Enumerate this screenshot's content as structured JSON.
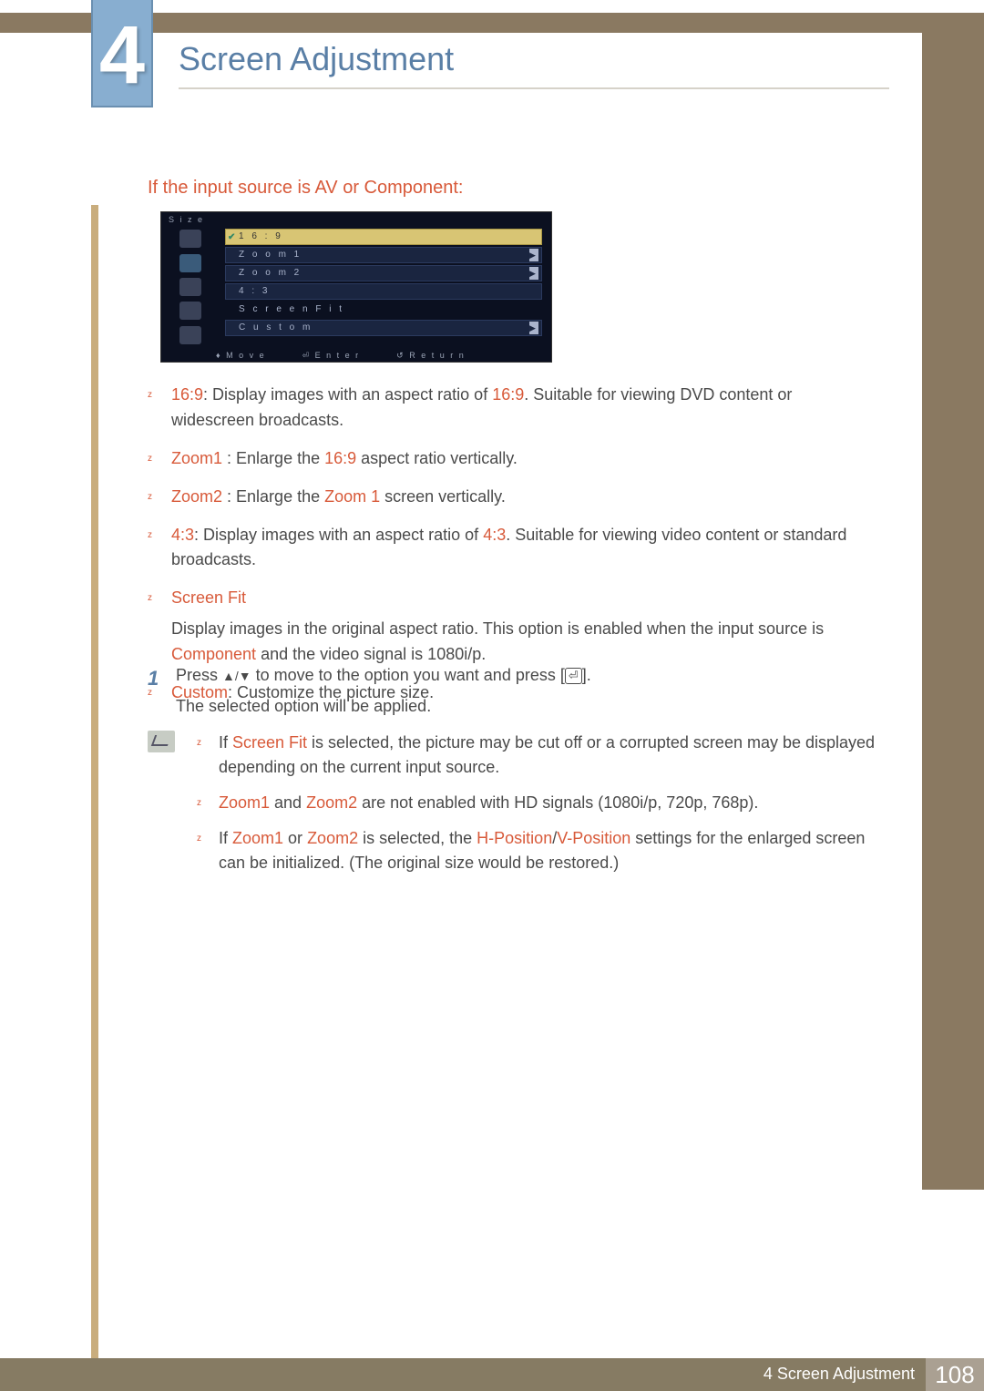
{
  "chapter": {
    "number": "4",
    "title": "Screen Adjustment"
  },
  "section_heading": "If the input source is AV or Component:",
  "osd": {
    "title": "S i z e",
    "rows": {
      "r0": "1 6 : 9",
      "r1": "Z o o m 1",
      "r2": "Z o o m 2",
      "r3": "4 : 3",
      "r4": "S c r e e n  F i t",
      "r5": "C u s t o m"
    },
    "footer": {
      "move": "M o v e",
      "enter": "E n t e r",
      "return": "R e t u r n"
    }
  },
  "items": {
    "i0": {
      "term": "16:9",
      "rest": ": Display images with an aspect ratio of ",
      "term2": "16:9",
      "rest2": ". Suitable for viewing DVD content or widescreen broadcasts."
    },
    "i1": {
      "term": "Zoom1",
      "rest": " : Enlarge the ",
      "term2": "16:9",
      "rest2": " aspect ratio vertically."
    },
    "i2": {
      "term": "Zoom2",
      "rest": " : Enlarge the ",
      "term2": "Zoom 1",
      "rest2": " screen vertically."
    },
    "i3": {
      "term": "4:3",
      "rest": ": Display images with an aspect ratio of ",
      "term2": "4:3",
      "rest2": ". Suitable for viewing video content or standard broadcasts."
    },
    "i4": {
      "term": "Screen Fit",
      "sub1a": "Display images in the original aspect ratio. This option is enabled when the input source is ",
      "sub1b": "Component",
      "sub1c": " and the video signal is 1080i/p."
    },
    "i5": {
      "term": "Custom",
      "rest": ": Customize the picture size."
    }
  },
  "step": {
    "num": "1",
    "line1a": "Press ",
    "line1b": " to move to the option you want and press [",
    "line1c": "].",
    "line2": "The selected option will be applied."
  },
  "notes": {
    "n0a": "If ",
    "n0b": "Screen Fit",
    "n0c": " is selected, the picture may be cut off or a corrupted screen may be displayed depending on the current input source.",
    "n1a": "Zoom1",
    "n1b": " and ",
    "n1c": "Zoom2",
    "n1d": " are not enabled with HD signals (1080i/p, 720p, 768p).",
    "n2a": "If ",
    "n2b": "Zoom1",
    "n2c": " or ",
    "n2d": "Zoom2",
    "n2e": " is selected, the ",
    "n2f": "H-Position",
    "n2g": "/",
    "n2h": "V-Position",
    "n2i": " settings for the enlarged screen can be initialized. (The original size would be restored.)"
  },
  "footer": {
    "label": "4 Screen Adjustment",
    "page": "108"
  }
}
